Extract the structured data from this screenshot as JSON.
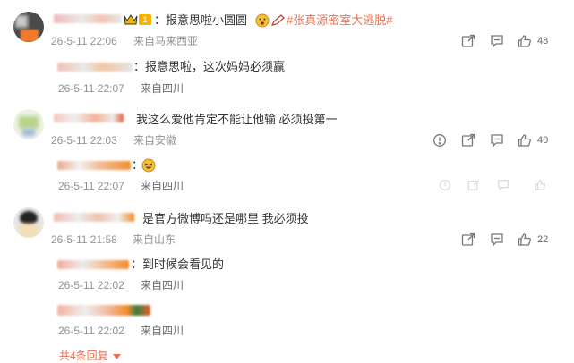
{
  "comments": [
    {
      "text": "：报意思啦小圆圆",
      "hashtag": "#张真源密室大逃脱#",
      "badge": "1",
      "time": "26-5-11 22:06",
      "location": "来自马来西亚",
      "likes": "48",
      "replies": [
        {
          "text": "：报意思啦，这次妈妈必须赢",
          "time": "26-5-11 22:07",
          "location": "来自四川"
        }
      ]
    },
    {
      "text": "我这么爱他肯定不能让他输 必须投第一",
      "time": "26-5-11 22:03",
      "location": "来自安徽",
      "likes": "40",
      "replies": [
        {
          "text": "：",
          "time": "26-5-11 22:07",
          "location": "来自四川"
        }
      ]
    },
    {
      "text": "是官方微博吗还是哪里 我必须投",
      "time": "26-5-11 21:58",
      "location": "来自山东",
      "likes": "22",
      "replies": [
        {
          "text": "：到时候会看见的",
          "time": "26-5-11 22:02",
          "location": "来自四川"
        },
        {
          "text": "",
          "time": "26-5-11 22:02",
          "location": "来自四川"
        }
      ],
      "more_label": "共4条回复"
    }
  ],
  "icons": {
    "share": "share-icon",
    "comment": "comment-icon",
    "like": "thumbs-up-icon",
    "report": "report-icon",
    "crown": "crown-icon",
    "emoji": "emoji-icon"
  },
  "colors": {
    "accent": "#eb7350",
    "meta": "#939393",
    "badge": "#f7b500"
  }
}
